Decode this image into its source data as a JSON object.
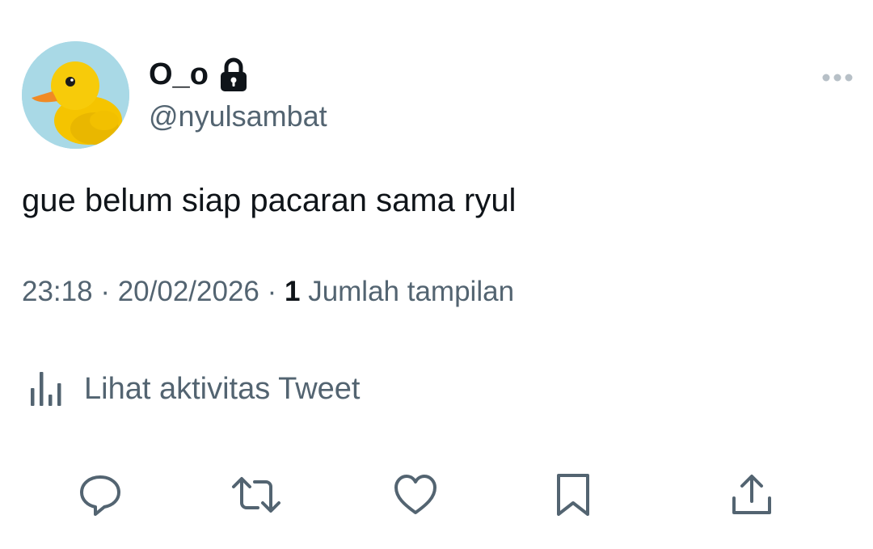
{
  "tweet": {
    "display_name": "O_o",
    "handle": "@nyulsambat",
    "protected": true,
    "text": "gue belum siap pacaran sama ryul",
    "time": "23:18",
    "date": "20/02/2026",
    "separator": " · ",
    "views_count": "1",
    "views_label": "Jumlah tampilan",
    "activity_label": "Lihat aktivitas Tweet"
  },
  "icons": {
    "avatar": "rubber-duck-avatar",
    "lock": "lock-icon",
    "more": "more-icon",
    "activity": "bar-chart-icon",
    "reply": "reply-icon",
    "retweet": "retweet-icon",
    "like": "heart-icon",
    "bookmark": "bookmark-icon",
    "share": "share-icon"
  },
  "colors": {
    "primary_text": "#0f1419",
    "secondary_text": "#536471",
    "icon": "#536471",
    "background": "#ffffff"
  }
}
